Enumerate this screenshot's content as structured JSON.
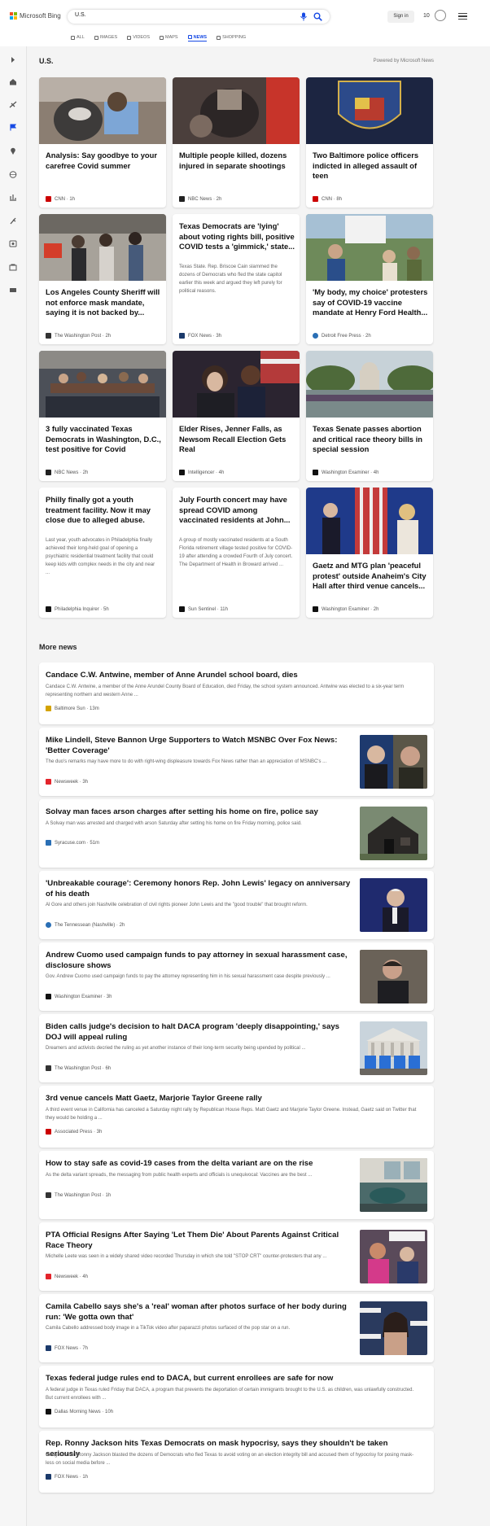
{
  "brand": {
    "name": "Microsoft Bing",
    "colors": [
      "#f25022",
      "#7fba00",
      "#00a4ef",
      "#ffb900"
    ]
  },
  "search": {
    "query": "U.S."
  },
  "header": {
    "signin": "Sign in",
    "points": "10"
  },
  "tabs": [
    {
      "label": "ALL",
      "icon": "search-icon"
    },
    {
      "label": "IMAGES",
      "icon": "image-icon"
    },
    {
      "label": "VIDEOS",
      "icon": "video-icon"
    },
    {
      "label": "MAPS",
      "icon": "map-pin-icon"
    },
    {
      "label": "NEWS",
      "icon": "news-icon",
      "active": true
    },
    {
      "label": "SHOPPING",
      "icon": "tag-icon"
    }
  ],
  "rail": [
    "expand-icon",
    "home-icon",
    "sports-icon",
    "flag-icon",
    "location-icon",
    "globe-icon",
    "business-icon",
    "science-icon",
    "entertainment-icon",
    "money-icon",
    "tech-icon"
  ],
  "section": {
    "title": "U.S.",
    "powered": "Powered by Microsoft News"
  },
  "cards": [
    {
      "title": "Analysis: Say goodbye to your carefree Covid summer",
      "source": "CNN · 1h",
      "source_color": "#cc0000",
      "thumb_color": "#8a7f75"
    },
    {
      "title": "Multiple people killed, dozens injured in separate shootings",
      "source": "NBC News · 2h",
      "source_color": "#222222",
      "thumb_color": "#6b5a55"
    },
    {
      "title": "Two Baltimore police officers indicted in alleged assault of teen",
      "source": "CNN · 8h",
      "source_color": "#cc0000",
      "thumb_color": "#1d2d52"
    },
    {
      "title": "Los Angeles County Sheriff will not enforce mask mandate, saying it is not backed by...",
      "source": "The Washington Post · 2h",
      "source_color": "#333333",
      "thumb_color": "#6e6a64"
    },
    {
      "title": "Texas Democrats are 'lying' about voting rights bill, positive COVID tests a 'gimmick,' state...",
      "snippet": "Texas State. Rep. Briscoe Cain slammed the dozens of Democrats who fled the state capitol earlier this week and argued they left purely for political reasons.",
      "source": "FOX News · 3h",
      "source_color": "#1b3a6b"
    },
    {
      "title": "'My body, my choice' protesters say of COVID-19 vaccine mandate at Henry Ford Health...",
      "source": "Detroit Free Press · 2h",
      "source_color": "#2a6fb5",
      "thumb_color": "#8aa0b5"
    },
    {
      "title": "3 fully vaccinated Texas Democrats in Washington, D.C., test positive for Covid",
      "source": "NBC News · 2h",
      "source_color": "#222222",
      "thumb_color": "#555b66"
    },
    {
      "title": "Elder Rises, Jenner Falls, as Newsom Recall Election Gets Real",
      "source": "Intelligencer · 4h",
      "source_color": "#111111",
      "thumb_color": "#3c2a26"
    },
    {
      "title": "Texas Senate passes abortion and critical race theory bills in special session",
      "source": "Washington Examiner · 4h",
      "source_color": "#111111",
      "thumb_color": "#7e9aa8"
    },
    {
      "title": "Philly finally got a youth treatment facility. Now it may close due to alleged abuse.",
      "snippet": "Last year, youth advocates in Philadelphia finally achieved their long-held goal of opening a psychiatric residential treatment facility that could keep kids with complex needs in the city and near ...",
      "source": "Philadelphia Inquirer · 5h",
      "source_color": "#111111"
    },
    {
      "title": "July Fourth concert may have spread COVID among vaccinated residents at John...",
      "snippet": "A group of mostly vaccinated residents at a South Florida retirement village tested positive for COVID-19 after attending a crowded Fourth of July concert. The Department of Health in Broward arrived ...",
      "source": "Sun Sentinel · 11h",
      "source_color": "#111111"
    },
    {
      "title": "Gaetz and MTG plan 'peaceful protest' outside Anaheim's City Hall after third venue cancels...",
      "source": "Washington Examiner · 2h",
      "source_color": "#111111",
      "thumb_color": "#2c3f7a"
    }
  ],
  "more_news": {
    "title": "More news",
    "items": [
      {
        "title": "Candace C.W. Antwine, member of Anne Arundel school board, dies",
        "snippet": "Candace C.W. Antwine, a member of the Anne Arundel County Board of Education, died Friday, the school system announced. Antwine was elected to a six-year term representing northern and western Anne ...",
        "source": "Baltimore Sun · 13m",
        "source_color": "#d4a300"
      },
      {
        "title": "Mike Lindell, Steve Bannon Urge Supporters to Watch MSNBC Over Fox News: 'Better Coverage'",
        "snippet": "The duo's remarks may have more to do with right-wing displeasure towards Fox News rather than an appreciation of MSNBC's ...",
        "source": "Newsweek · 3h",
        "source_color": "#e3242b",
        "thumb_color": "#3b3f4a"
      },
      {
        "title": "Solvay man faces arson charges after setting his home on fire, police say",
        "snippet": "A Solvay man was arrested and charged with arson Saturday after setting his home on fire Friday morning, police said.",
        "source": "Syracuse.com · 51m",
        "source_color": "#2a6fb5",
        "thumb_color": "#4a5046"
      },
      {
        "title": "'Unbreakable courage': Ceremony honors Rep. John Lewis' legacy on anniversary of his death",
        "snippet": "Al Gore and others join Nashville celebration of civil rights pioneer John Lewis and the \"good trouble\" that brought reform.",
        "source": "The Tennessean (Nashville) · 2h",
        "source_color": "#2a6fb5",
        "thumb_color": "#1f2a6e"
      },
      {
        "title": "Andrew Cuomo used campaign funds to pay attorney in sexual harassment case, disclosure shows",
        "snippet": "Gov. Andrew Cuomo used campaign funds to pay the attorney representing him in his sexual harassment case despite previously ...",
        "source": "Washington Examiner · 3h",
        "source_color": "#111111",
        "thumb_color": "#3a3633"
      },
      {
        "title": "Biden calls judge's decision to halt DACA program 'deeply disappointing,' says DOJ will appeal ruling",
        "snippet": "Dreamers and activists decried the ruling as yet another instance of their long-term security being upended by political ...",
        "source": "The Washington Post · 6h",
        "source_color": "#333333",
        "thumb_color": "#9ab0c2"
      },
      {
        "title": "3rd venue cancels Matt Gaetz, Marjorie Taylor Greene rally",
        "snippet": "A third event venue in California has canceled a Saturday night rally by Republican House Reps. Matt Gaetz and Marjorie Taylor Greene. Instead, Gaetz said on Twitter that they would be holding a ...",
        "source": "Associated Press · 3h",
        "source_color": "#cc0000"
      },
      {
        "title": "How to stay safe as covid-19 cases from the delta variant are on the rise",
        "snippet": "As the delta variant spreads, the messaging from public health experts and officials is unequivocal: Vaccines are the best ...",
        "source": "The Washington Post · 1h",
        "source_color": "#333333",
        "thumb_color": "#4b6a6a"
      },
      {
        "title": "PTA Official Resigns After Saying 'Let Them Die' About Parents Against Critical Race Theory",
        "snippet": "Michelle Leete was seen in a widely shared video recorded Thursday in which she told \"STOP CRT\" counter-protesters that any ...",
        "source": "Newsweek · 4h",
        "source_color": "#e3242b",
        "thumb_color": "#7a3b5a"
      },
      {
        "title": "Camila Cabello says she's a 'real' woman after photos surface of her body during run: 'We gotta own that'",
        "snippet": "Camila Cabello addressed body image in a TikTok video after paparazzi photos surfaced of the pop star on a run.",
        "source": "FOX News · 7h",
        "source_color": "#1b3a6b",
        "thumb_color": "#2a3a5e"
      },
      {
        "title": "Texas federal judge rules end to DACA, but current enrollees are safe for now",
        "snippet": "A federal judge in Texas ruled Friday that DACA, a program that prevents the deportation of certain immigrants brought to the U.S. as children, was unlawfully constructed. But current enrollees with ...",
        "source": "Dallas Morning News · 10h",
        "source_color": "#111111"
      },
      {
        "title": "Rep. Ronny Jackson hits Texas Democrats on mask hypocrisy, says they shouldn't be taken seriously",
        "snippet": "Congressman Ronny Jackson blasted the dozens of Democrats who fled Texas to avoid voting on an election integrity bill and accused them of hypocrisy for posing mask-less on social media before ...",
        "source": "FOX News · 1h",
        "source_color": "#1b3a6b"
      }
    ]
  }
}
